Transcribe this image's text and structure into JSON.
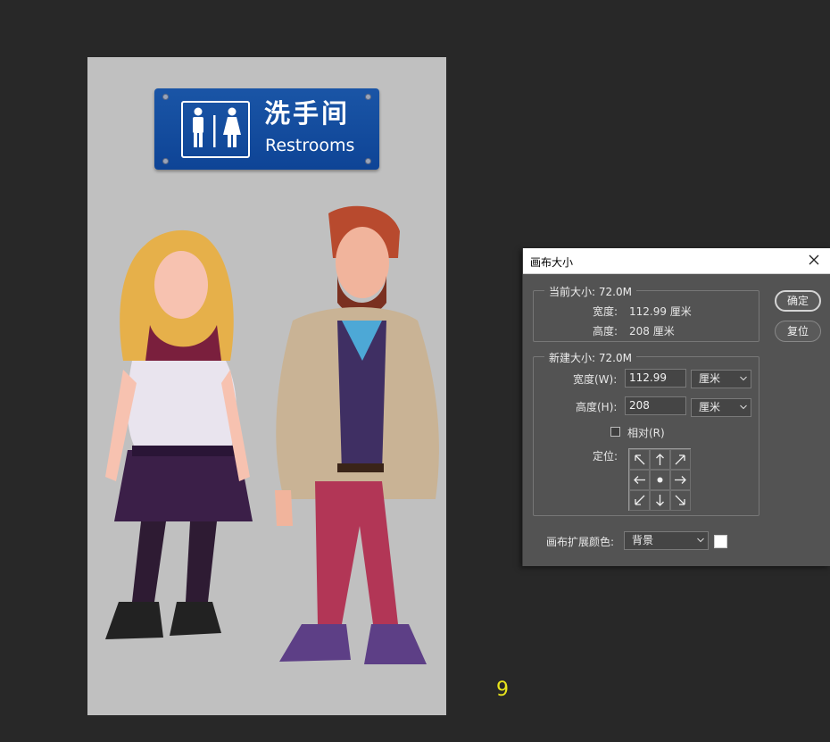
{
  "sign": {
    "chinese": "洗手间",
    "english": "Restrooms"
  },
  "page_number": "9",
  "dialog": {
    "title": "画布大小",
    "current": {
      "legend": "当前大小: 72.0M",
      "width_label": "宽度:",
      "width_value": "112.99 厘米",
      "height_label": "高度:",
      "height_value": "208 厘米"
    },
    "new_size": {
      "legend": "新建大小: 72.0M",
      "width_label": "宽度(W):",
      "width_value": "112.99",
      "width_unit": "厘米",
      "height_label": "高度(H):",
      "height_value": "208",
      "height_unit": "厘米",
      "relative_label": "相对(R)",
      "anchor_label": "定位:"
    },
    "extension_color_label": "画布扩展颜色:",
    "extension_color_value": "背景",
    "ok_label": "确定",
    "reset_label": "复位",
    "colors": {
      "swatch": "#ffffff",
      "sign_blue": "#1a55a6",
      "canvas_gray": "#c0c0c0"
    }
  }
}
